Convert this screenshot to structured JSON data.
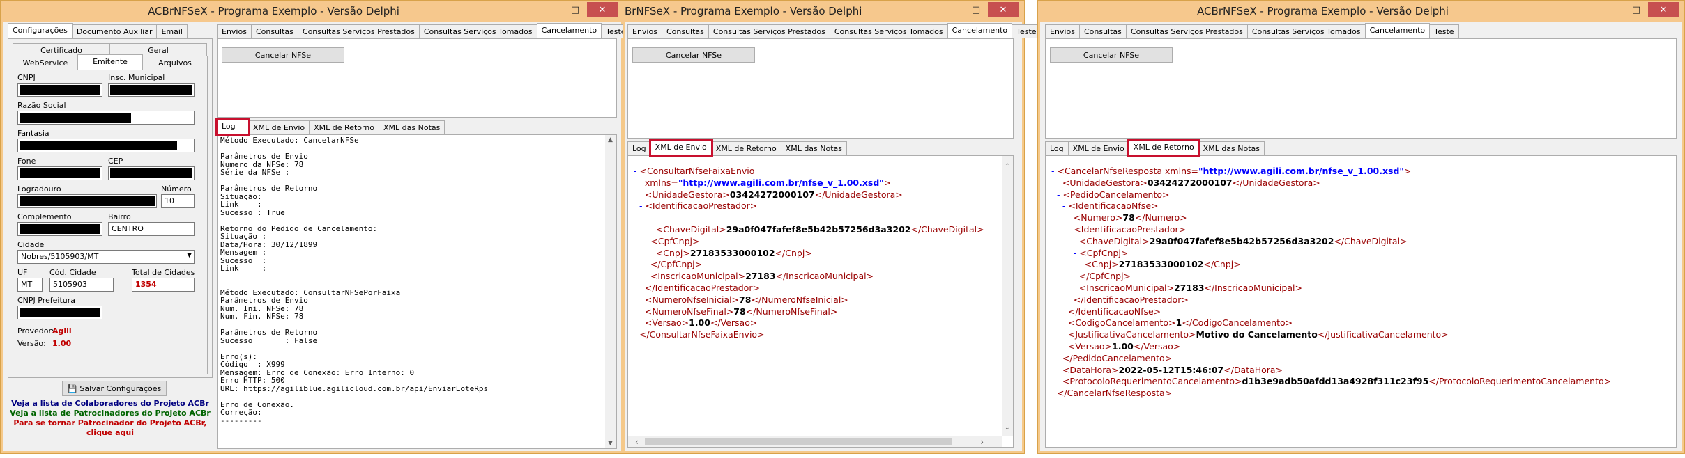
{
  "win1": {
    "title": "ACBrNFSeX - Programa Exemplo - Versão Delphi",
    "left_tabs": [
      "Configurações",
      "Documento Auxiliar",
      "Email"
    ],
    "sub_tabs_row1": [
      "Certificado",
      "Geral"
    ],
    "sub_tabs_row2": [
      "WebService",
      "Emitente",
      "Arquivos"
    ],
    "fields": {
      "cnpj": "CNPJ",
      "insc_municipal": "Insc. Municipal",
      "razao_social": "Razão Social",
      "fantasia": "Fantasia",
      "fone": "Fone",
      "cep": "CEP",
      "logradouro": "Logradouro",
      "numero": "Número",
      "numero_value": "10",
      "complemento": "Complemento",
      "bairro": "Bairro",
      "bairro_value": "CENTRO",
      "cidade": "Cidade",
      "cidade_value": "Nobres/5105903/MT",
      "uf": "UF",
      "uf_value": "MT",
      "cod_cidade": "Cód. Cidade",
      "cod_cidade_value": "5105903",
      "total_cidades": "Total de Cidades",
      "total_cidades_value": "1354",
      "cnpj_prefeitura": "CNPJ Prefeitura",
      "provedor": "Provedor:",
      "provedor_value": "Agili",
      "versao": "Versão:",
      "versao_value": "1.00"
    },
    "save_button": "Salvar Configurações",
    "links": {
      "colaboradores": "Veja a lista de Colaboradores do Projeto ACBr",
      "patrocinadores": "Veja a lista de Patrocinadores do Projeto ACBr",
      "tornar": "Para se tornar Patrocinador do Projeto ACBr,",
      "clique": "clique aqui"
    },
    "right_tabs": [
      "Envios",
      "Consultas",
      "Consultas Serviços Prestados",
      "Consultas Serviços Tomados",
      "Cancelamento",
      "Teste"
    ],
    "cancel_button": "Cancelar NFSe",
    "log_tabs": [
      "Log",
      "XML de Envio",
      "XML de Retorno",
      "XML das Notas"
    ],
    "log_lines": [
      "Método Executado: CancelarNFSe",
      "",
      "Parâmetros de Envio",
      "Numero da NFSe: 78",
      "Série da NFSe :",
      "",
      "Parâmetros de Retorno",
      "Situação:",
      "Link    :",
      "Sucesso : True",
      "",
      "Retorno do Pedido de Cancelamento:",
      "Situação :",
      "Data/Hora: 30/12/1899",
      "Mensagem :",
      "Sucesso  :",
      "Link     :",
      "",
      "",
      "Método Executado: ConsultarNFSePorFaixa",
      "Parâmetros de Envio",
      "Num. Ini. NFSe: 78",
      "Num. Fin. NFSe: 78",
      "",
      "Parâmetros de Retorno",
      "Sucesso       : False",
      "",
      "Erro(s):",
      "Código  : X999",
      "Mensagem: Erro de Conexão: Erro Interno: 0",
      "Erro HTTP: 500",
      "URL: https://agiliblue.agilicloud.com.br/api/EnviarLoteRps",
      "",
      "Erro de Conexão.",
      "Correção:",
      "---------"
    ]
  },
  "win2": {
    "title": "BrNFSeX - Programa Exemplo - Versão Delphi",
    "right_tabs": [
      "Envios",
      "Consultas",
      "Consultas Serviços Prestados",
      "Consultas Serviços Tomados",
      "Cancelamento",
      "Teste"
    ],
    "cancel_button": "Cancelar NFSe",
    "log_tabs": [
      "Log",
      "XML de Envio",
      "XML de Retorno",
      "XML das Notas"
    ],
    "xml": {
      "l1": "<ConsultarNfseFaixaEnvio",
      "ns_attr": "xmlns=",
      "ns_val": "\"http://www.agili.com.br/nfse_v_1.00.xsd\"",
      "ug_open": "<UnidadeGestora>",
      "ug_val": "03424272000107",
      "ug_close": "</UnidadeGestora>",
      "ip_open": "<IdentificacaoPrestador>",
      "cd_open": "<ChaveDigital>",
      "cd_val": "29a0f047fafef8e5b42b57256d3a3202",
      "cd_close": "</ChaveDigital>",
      "cc_open": "<CpfCnpj>",
      "cnpj_open": "<Cnpj>",
      "cnpj_val": "27183533000102",
      "cnpj_close": "</Cnpj>",
      "cc_close": "</CpfCnpj>",
      "im_open": "<InscricaoMunicipal>",
      "im_val": "27183",
      "im_close": "</InscricaoMunicipal>",
      "ip_close": "</IdentificacaoPrestador>",
      "ni_open": "<NumeroNfseInicial>",
      "ni_val": "78",
      "ni_close": "</NumeroNfseInicial>",
      "nf_open": "<NumeroNfseFinal>",
      "nf_val": "78",
      "nf_close": "</NumeroNfseFinal>",
      "v_open": "<Versao>",
      "v_val": "1.00",
      "v_close": "</Versao>",
      "root_close": "</ConsultarNfseFaixaEnvio>"
    }
  },
  "win3": {
    "title": "ACBrNFSeX - Programa Exemplo - Versão Delphi",
    "right_tabs": [
      "Envios",
      "Consultas",
      "Consultas Serviços Prestados",
      "Consultas Serviços Tomados",
      "Cancelamento",
      "Teste"
    ],
    "cancel_button": "Cancelar NFSe",
    "log_tabs": [
      "Log",
      "XML de Envio",
      "XML de Retorno",
      "XML das Notas"
    ],
    "xml": {
      "root_open": "<CancelarNfseResposta",
      "ns_attr": "xmlns=",
      "ns_val": "\"http://www.agili.com.br/nfse_v_1.00.xsd\"",
      "root_end": ">",
      "ug_open": "<UnidadeGestora>",
      "ug_val": "03424272000107",
      "ug_close": "</UnidadeGestora>",
      "pc_open": "<PedidoCancelamento>",
      "in_open": "<IdentificacaoNfse>",
      "num_open": "<Numero>",
      "num_val": "78",
      "num_close": "</Numero>",
      "ip_open": "<IdentificacaoPrestador>",
      "cd_open": "<ChaveDigital>",
      "cd_val": "29a0f047fafef8e5b42b57256d3a3202",
      "cd_close": "</ChaveDigital>",
      "cc_open": "<CpfCnpj>",
      "cnpj_open": "<Cnpj>",
      "cnpj_val": "27183533000102",
      "cnpj_close": "</Cnpj>",
      "cc_close": "</CpfCnpj>",
      "im_open": "<InscricaoMunicipal>",
      "im_val": "27183",
      "im_close": "</InscricaoMunicipal>",
      "ip_close": "</IdentificacaoPrestador>",
      "in_close": "</IdentificacaoNfse>",
      "cod_open": "<CodigoCancelamento>",
      "cod_val": "1",
      "cod_close": "</CodigoCancelamento>",
      "jc_open": "<JustificativaCancelamento>",
      "jc_val": "Motivo do Cancelamento",
      "jc_close": "</JustificativaCancelamento>",
      "v_open": "<Versao>",
      "v_val": "1.00",
      "v_close": "</Versao>",
      "pc_close": "</PedidoCancelamento>",
      "dh_open": "<DataHora>",
      "dh_val": "2022-05-12T15:46:07",
      "dh_close": "</DataHora>",
      "pr_open": "<ProtocoloRequerimentoCancelamento>",
      "pr_val": "d1b3e9adb50afdd13a4928f311c23f95",
      "pr_close": "</ProtocoloRequerimentoCancelamento>",
      "root_close": "</CancelarNfseResposta>"
    }
  },
  "colors": {
    "title_bg": "#f6c88d",
    "highlight": "#c8102e",
    "link_blue": "#000080",
    "link_green": "#006400",
    "link_red": "#c00000",
    "xml_tag": "#990000",
    "xml_attr_val": "#0000ff"
  }
}
